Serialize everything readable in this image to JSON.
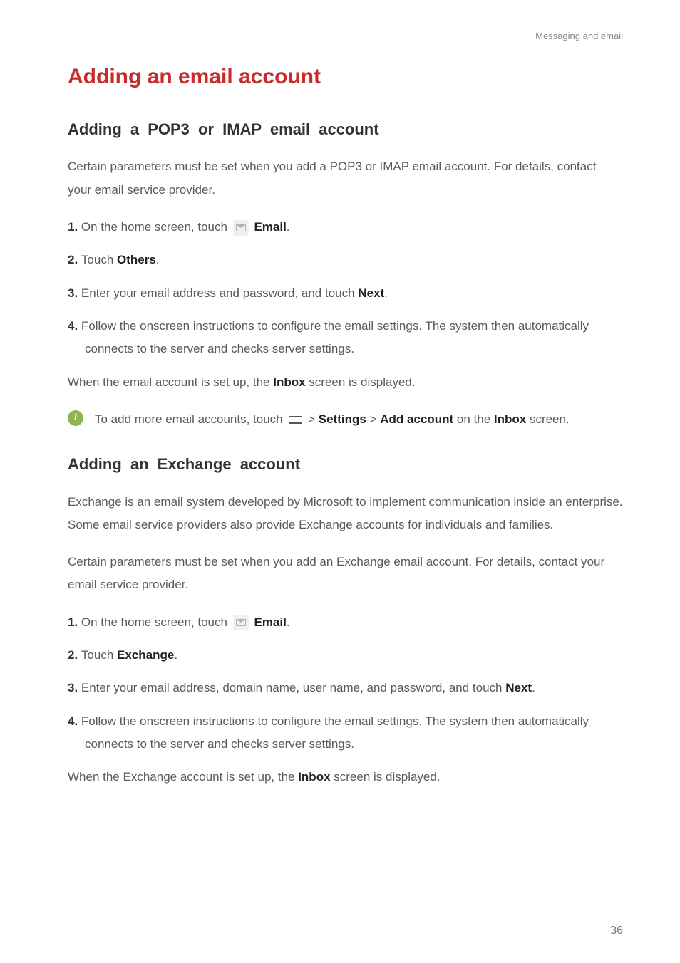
{
  "header": "Messaging and email",
  "h1": "Adding an email account",
  "section1": {
    "title": "Adding a POP3 or IMAP email account",
    "intro": "Certain parameters must be set when you add a POP3 or IMAP email account. For details, contact your email service provider.",
    "steps": {
      "s1_a": "On the home screen, touch",
      "s1_b": "Email",
      "s2_a": "Touch ",
      "s2_b": "Others",
      "s3_a": "Enter your email address and password, and touch ",
      "s3_b": "Next",
      "s4": "Follow the onscreen instructions to configure the email settings. The system then automatically connects to the server and checks server settings."
    },
    "after_a": "When the email account is set up, the ",
    "after_b": "Inbox",
    "after_c": " screen is displayed.",
    "tip_a": "To add more email accounts, touch",
    "tip_b": "Settings",
    "tip_c": "Add account",
    "tip_d": " on the ",
    "tip_e": "Inbox",
    "tip_f": " screen."
  },
  "section2": {
    "title": "Adding an Exchange account",
    "intro1": "Exchange is an email system developed by Microsoft to implement communication inside an enterprise. Some email service providers also provide Exchange accounts for individuals and families.",
    "intro2": "Certain parameters must be set when you add an Exchange email account. For details, contact your email service provider.",
    "steps": {
      "s1_a": "On the home screen, touch",
      "s1_b": "Email",
      "s2_a": "Touch ",
      "s2_b": "Exchange",
      "s3_a": "Enter your email address, domain name, user name, and password, and touch ",
      "s3_b": "Next",
      "s4": "Follow the onscreen instructions to configure the email settings. The system then automatically connects to the server and checks server settings."
    },
    "after_a": "When the Exchange account is set up, the ",
    "after_b": "Inbox",
    "after_c": " screen is displayed."
  },
  "page_number": "36"
}
